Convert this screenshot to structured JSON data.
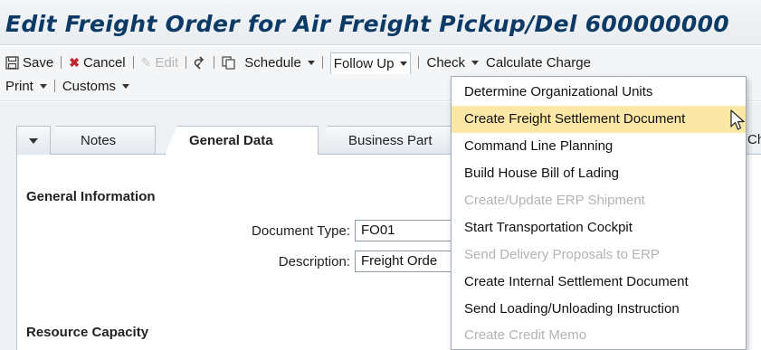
{
  "window": {
    "title": "Edit Freight Order for Air Freight Pickup/Del 600000000"
  },
  "toolbar": {
    "save": "Save",
    "cancel": "Cancel",
    "edit": "Edit",
    "schedule": "Schedule",
    "follow_up": "Follow Up",
    "check": "Check",
    "calculate_charges": "Calculate Charge",
    "print": "Print",
    "customs": "Customs"
  },
  "tabs": [
    {
      "label": "Notes",
      "active": false
    },
    {
      "label": "General Data",
      "active": true
    },
    {
      "label": "Business Part",
      "active": false
    },
    {
      "label": "Ch",
      "active": false
    }
  ],
  "general_information": {
    "title": "General Information",
    "document_type_label": "Document Type:",
    "document_type_value": "FO01",
    "description_label": "Description:",
    "description_value": "Freight Orde"
  },
  "resource_capacity": {
    "title": "Resource Capacity"
  },
  "follow_up_menu": {
    "items": [
      {
        "label": "Determine Organizational Units",
        "enabled": true
      },
      {
        "label": "Create Freight Settlement Document",
        "enabled": true,
        "highlighted": true
      },
      {
        "label": "Command Line Planning",
        "enabled": true
      },
      {
        "label": "Build House Bill of Lading",
        "enabled": true
      },
      {
        "label": "Create/Update ERP Shipment",
        "enabled": false
      },
      {
        "label": "Start Transportation Cockpit",
        "enabled": true
      },
      {
        "label": "Send Delivery Proposals to ERP",
        "enabled": false
      },
      {
        "label": "Create Internal Settlement Document",
        "enabled": true
      },
      {
        "label": "Send Loading/Unloading Instruction",
        "enabled": true
      },
      {
        "label": "Create Credit Memo",
        "enabled": false
      }
    ]
  },
  "colors": {
    "title_text": "#0b3a66",
    "highlight": "#fbe7a6",
    "cancel_icon": "#c0262d",
    "disabled_text": "#b3b3b3"
  }
}
